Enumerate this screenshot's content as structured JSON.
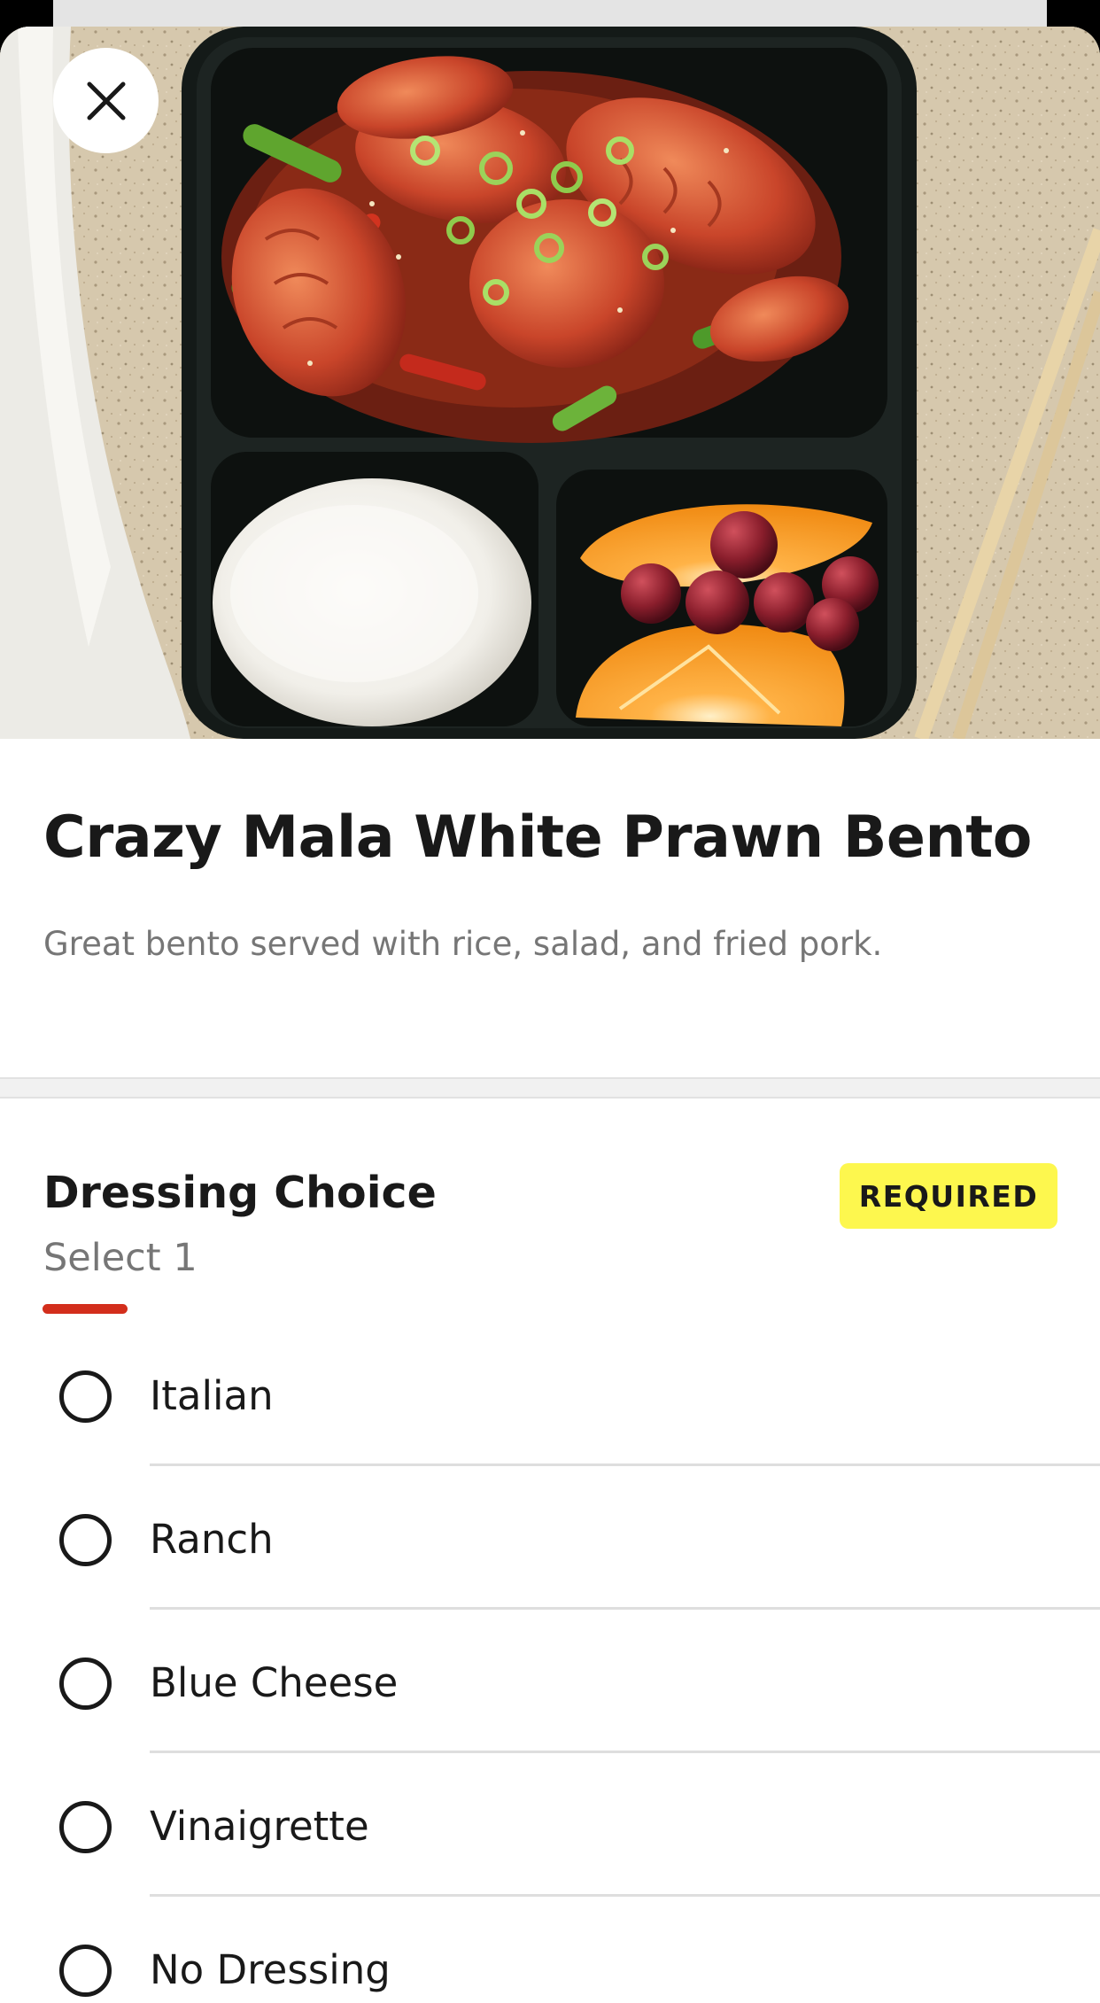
{
  "item": {
    "name": "Crazy Mala White Prawn Bento",
    "description": "Great bento served with rice, salad, and fried pork."
  },
  "option_group": {
    "title": "Dressing Choice",
    "subtitle": "Select 1",
    "badge": "REQUIRED",
    "options": [
      {
        "label": "Italian",
        "selected": false
      },
      {
        "label": "Ranch",
        "selected": false
      },
      {
        "label": "Blue Cheese",
        "selected": false
      },
      {
        "label": "Vinaigrette",
        "selected": false
      },
      {
        "label": "No Dressing",
        "selected": false
      }
    ]
  },
  "colors": {
    "accent": "#d32e1c",
    "badge_background": "#fdf74e",
    "text_primary": "#191919",
    "text_secondary": "#767676"
  },
  "icons": {
    "close": "close-icon"
  }
}
